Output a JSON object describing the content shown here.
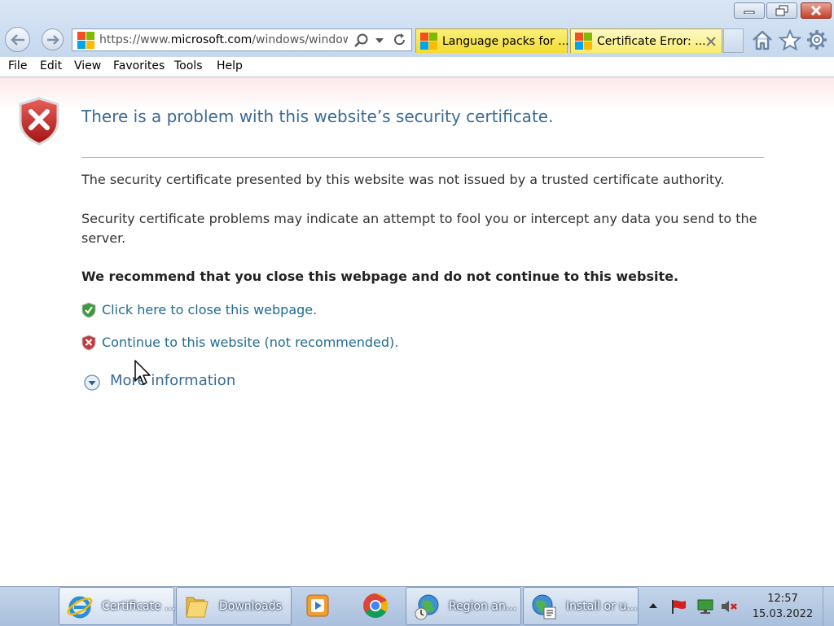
{
  "browser": {
    "address": {
      "prefix": "https://www.",
      "domain": "microsoft.com",
      "path": "/windows/windows"
    },
    "tabs": [
      {
        "label": "Language packs for ...",
        "active": false
      },
      {
        "label": "Certificate Error: ...",
        "active": true
      }
    ],
    "icons": {
      "back": "back-arrow-icon",
      "forward": "forward-arrow-icon",
      "search": "search-icon",
      "dropdown": "chevron-down-icon",
      "refresh": "refresh-icon",
      "home": "home-icon",
      "favorites": "star-icon",
      "tools": "gear-icon"
    }
  },
  "menu": [
    "File",
    "Edit",
    "View",
    "Favorites",
    "Tools",
    "Help"
  ],
  "page": {
    "heading": "There is a problem with this website’s security certificate.",
    "para1": "The security certificate presented by this website was not issued by a trusted certificate authority.",
    "para2": "Security certificate problems may indicate an attempt to fool you or intercept any data you send to the server.",
    "recommend": "We recommend that you close this webpage and do not continue to this website.",
    "close_link": "Click here to close this webpage.",
    "continue_link": "Continue to this website (not recommended).",
    "more_info": "More information"
  },
  "taskbar": {
    "items": [
      {
        "label": "Certificate ...",
        "icon": "internet-explorer-icon"
      },
      {
        "label": "Downloads",
        "icon": "folder-icon"
      },
      {
        "label": "",
        "icon": "media-player-icon"
      },
      {
        "label": "",
        "icon": "chrome-icon"
      },
      {
        "label": "Region an...",
        "icon": "region-globe-icon"
      },
      {
        "label": "Install or u...",
        "icon": "install-globe-icon"
      }
    ],
    "clock": {
      "time": "12:57",
      "date": "15.03.2022"
    }
  },
  "colors": {
    "heading": "#3a6a95",
    "link": "#1f6b8f",
    "shield_red": "#c62828",
    "shield_green": "#2e7d32",
    "tab_yellow": "#f2dc33"
  }
}
